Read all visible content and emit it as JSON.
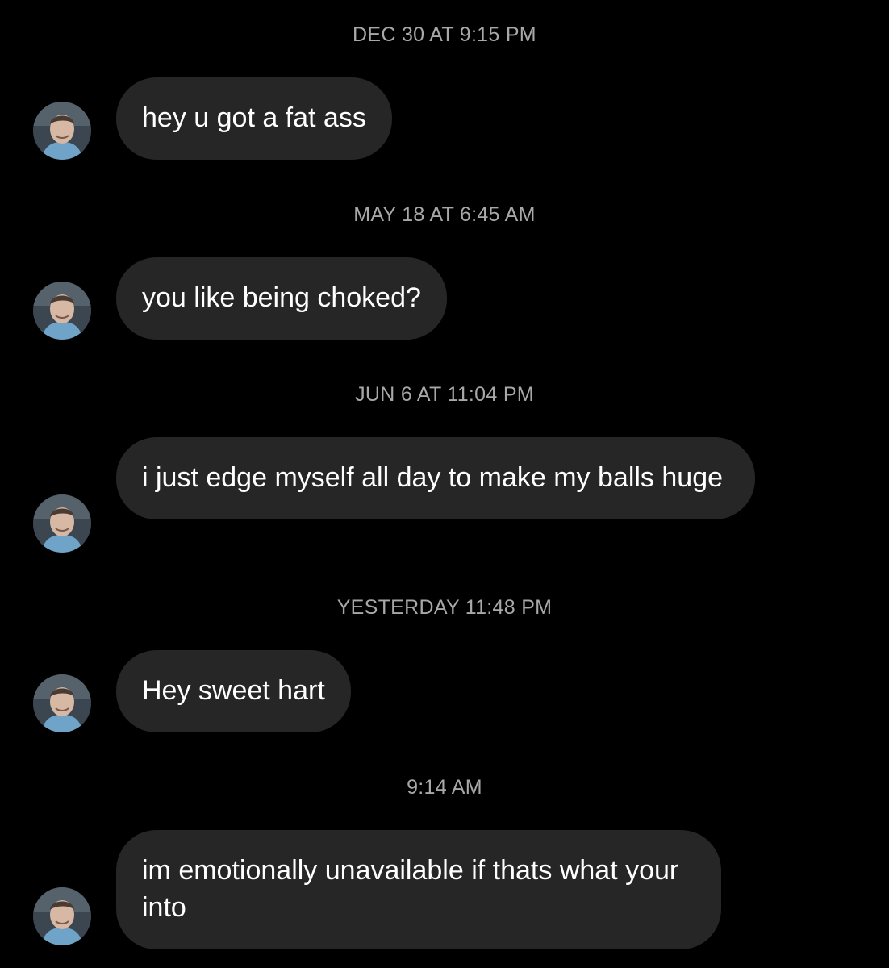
{
  "messages": [
    {
      "timestamp": "DEC 30 AT 9:15 PM",
      "text": "hey u got a fat ass"
    },
    {
      "timestamp": "MAY 18 AT 6:45 AM",
      "text": "you like being choked?"
    },
    {
      "timestamp": "JUN 6 AT 11:04 PM",
      "text": "i just edge myself all day to make my balls huge"
    },
    {
      "timestamp": "YESTERDAY 11:48 PM",
      "text": "Hey sweet hart"
    },
    {
      "timestamp": "9:14 AM",
      "text": "im emotionally unavailable if thats what your into"
    }
  ],
  "colors": {
    "background": "#000000",
    "bubble": "#262626",
    "timestamp": "#a8a8a8",
    "text": "#ffffff"
  },
  "icons": {
    "avatar": "sender-avatar-photo"
  }
}
